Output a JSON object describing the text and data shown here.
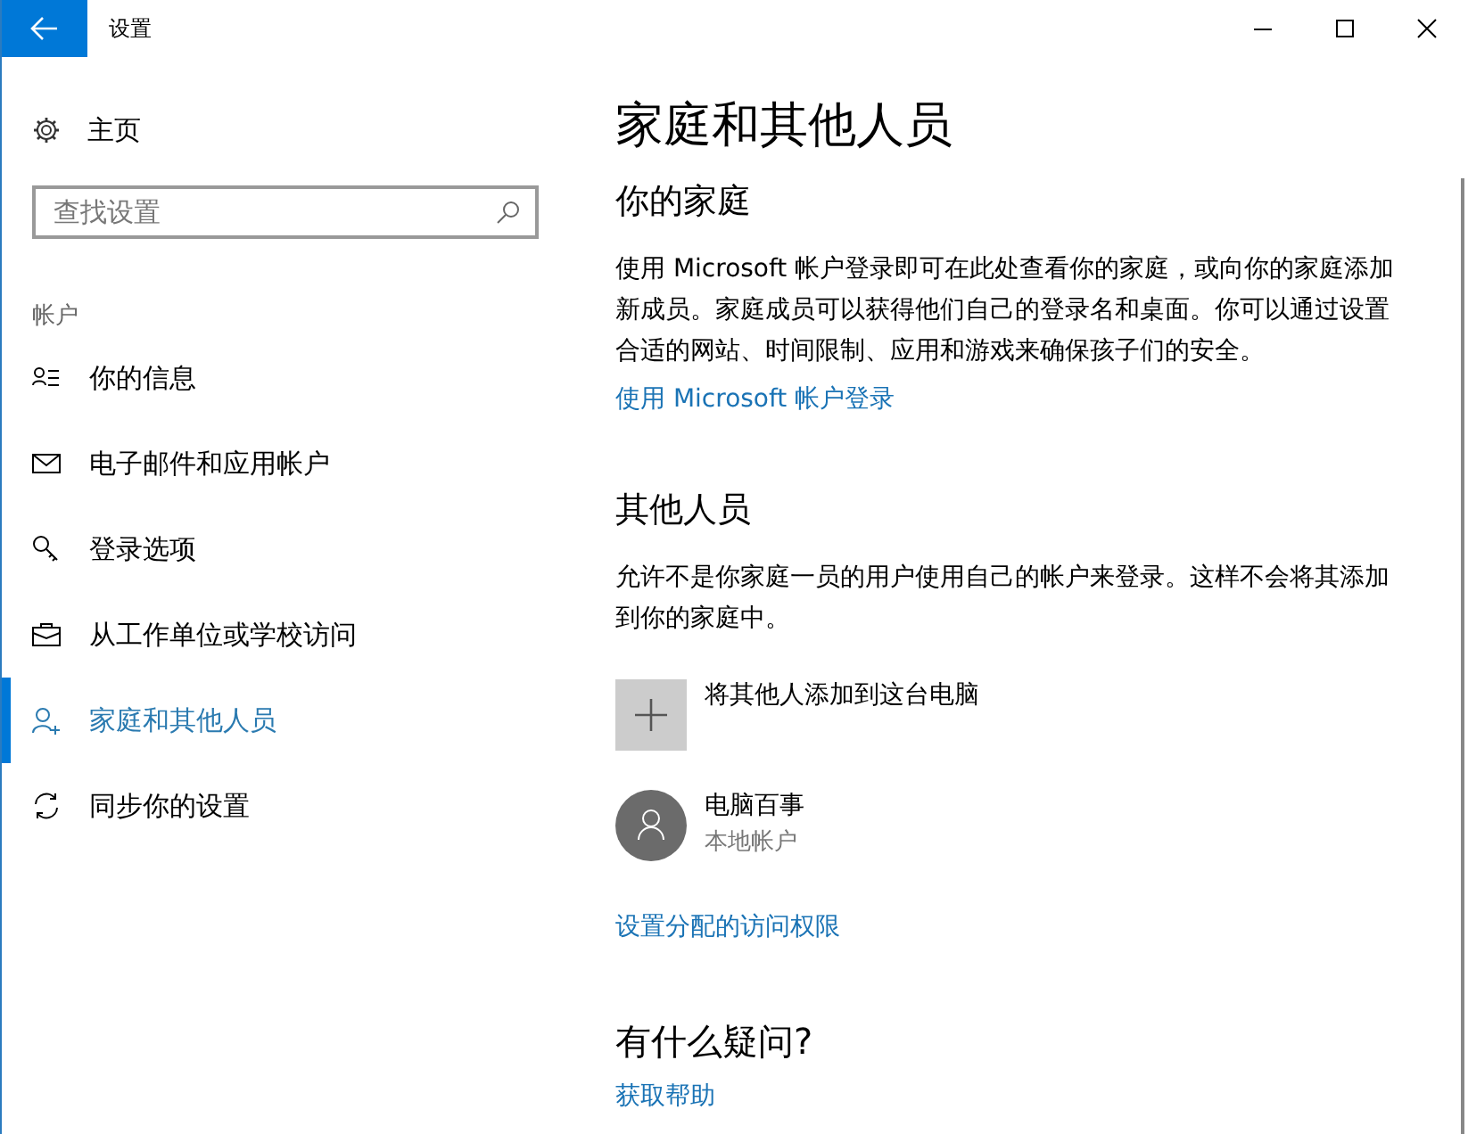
{
  "window": {
    "title": "设置"
  },
  "sidebar": {
    "home": "主页",
    "search": {
      "placeholder": "查找设置"
    },
    "section": "帐户",
    "items": [
      {
        "label": "你的信息",
        "selected": false
      },
      {
        "label": "电子邮件和应用帐户",
        "selected": false
      },
      {
        "label": "登录选项",
        "selected": false
      },
      {
        "label": "从工作单位或学校访问",
        "selected": false
      },
      {
        "label": "家庭和其他人员",
        "selected": true
      },
      {
        "label": "同步你的设置",
        "selected": false
      }
    ]
  },
  "page": {
    "title": "家庭和其他人员",
    "family": {
      "heading": "你的家庭",
      "text": "使用 Microsoft 帐户登录即可在此处查看你的家庭，或向你的家庭添加新成员。家庭成员可以获得他们自己的登录名和桌面。你可以通过设置合适的网站、时间限制、应用和游戏来确保孩子们的安全。",
      "link": "使用 Microsoft 帐户登录"
    },
    "others": {
      "heading": "其他人员",
      "text": "允许不是你家庭一员的用户使用自己的帐户来登录。这样不会将其添加到你的家庭中。",
      "add": "将其他人添加到这台电脑",
      "accounts": [
        {
          "name": "电脑百事",
          "type": "本地帐户"
        }
      ],
      "link": "设置分配的访问权限"
    },
    "help": {
      "heading": "有什么疑问?",
      "link": "获取帮助"
    }
  }
}
